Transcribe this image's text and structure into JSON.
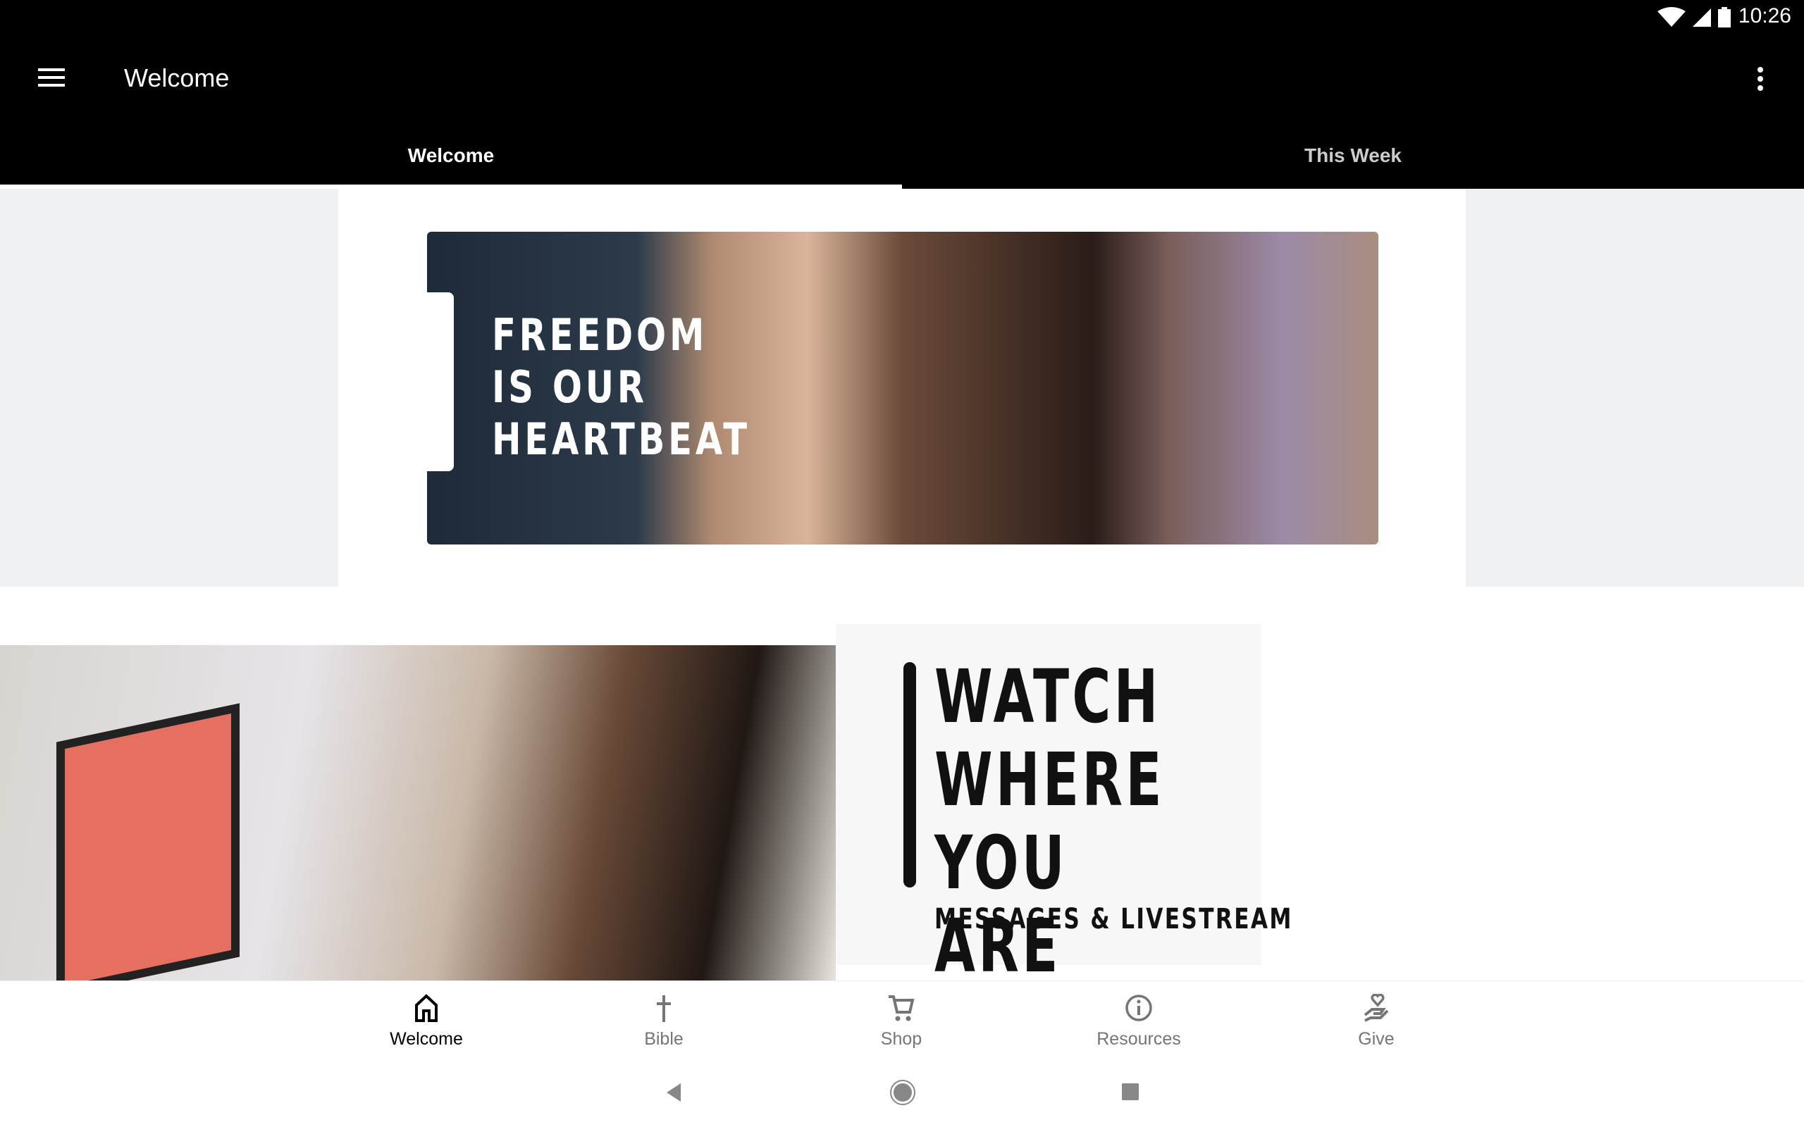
{
  "status_bar": {
    "time": "10:26",
    "icons": [
      "wifi-icon",
      "signal-icon",
      "battery-icon"
    ]
  },
  "app_bar": {
    "title": "Welcome",
    "menu_icon": "hamburger-icon",
    "overflow_icon": "more-vert-icon"
  },
  "tabs": [
    {
      "label": "Welcome",
      "active": true
    },
    {
      "label": "This Week",
      "active": false
    }
  ],
  "banner": {
    "lines": [
      "FREEDOM",
      "IS OUR",
      "HEARTBEAT"
    ]
  },
  "watch_card": {
    "lines": [
      "WATCH",
      "WHERE",
      "YOU ARE"
    ],
    "subtitle": "MESSAGES & LIVESTREAM"
  },
  "bottom_nav": [
    {
      "label": "Welcome",
      "icon": "home-icon",
      "active": true
    },
    {
      "label": "Bible",
      "icon": "cross-icon"
    },
    {
      "label": "Shop",
      "icon": "cart-icon"
    },
    {
      "label": "Resources",
      "icon": "info-icon"
    },
    {
      "label": "Give",
      "icon": "give-hand-icon"
    }
  ],
  "system_nav": [
    "back-icon",
    "home-circle-icon",
    "recents-icon"
  ]
}
